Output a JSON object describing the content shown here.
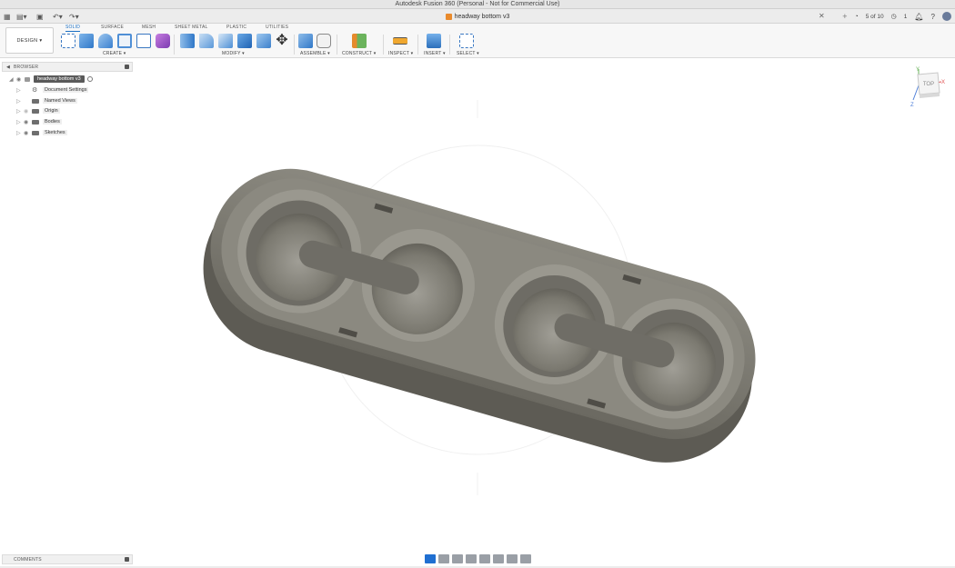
{
  "window": {
    "title": "Autodesk Fusion 360 (Personal - Not for Commercial Use)"
  },
  "document_tab": {
    "name": "headway bottom v3"
  },
  "header_right": {
    "page_counter": "5 of 10",
    "notifications": "1"
  },
  "toolbar": {
    "workspace": "DESIGN",
    "tabs": [
      "SOLID",
      "SURFACE",
      "MESH",
      "SHEET METAL",
      "PLASTIC",
      "UTILITIES"
    ],
    "active_tab": "SOLID",
    "groups": {
      "create": "CREATE",
      "modify": "MODIFY",
      "assemble": "ASSEMBLE",
      "construct": "CONSTRUCT",
      "inspect": "INSPECT",
      "insert": "INSERT",
      "select": "SELECT"
    }
  },
  "browser": {
    "title": "BROWSER",
    "root": "headway bottom v3",
    "items": [
      "Document Settings",
      "Named Views",
      "Origin",
      "Bodies",
      "Sketches"
    ]
  },
  "viewcube": {
    "face": "TOP",
    "axes": [
      "Y",
      "X",
      "Z"
    ]
  },
  "comments": {
    "title": "COMMENTS"
  },
  "colors": {
    "accent": "#1a6fc4",
    "model": "#7c7a73"
  }
}
